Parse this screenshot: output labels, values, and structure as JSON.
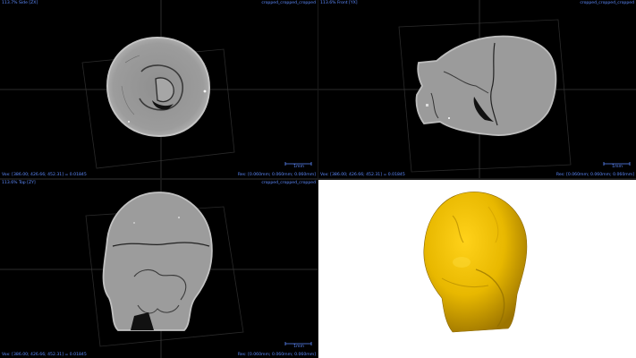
{
  "viewports": {
    "side": {
      "zoom_view": "113.7%   Side [ZX]",
      "dataset": "cropped_cropped_cropped",
      "voxel_info": "Vox:  [386.00; 426.66; 452.31] = 0.01845",
      "resolution": "Res: [0.060mm; 0.060mm; 0.060mm]",
      "scale_label": "1mm"
    },
    "front": {
      "zoom_view": "113.6%   Front [YX]",
      "dataset": "cropped_cropped_cropped",
      "voxel_info": "Vox:  [386.00; 426.66; 452.31] = 0.01845",
      "resolution": "Res: [0.060mm; 0.060mm; 0.060mm]",
      "scale_label": "1mm"
    },
    "top": {
      "zoom_view": "113.6%   Top [ZY]",
      "dataset": "cropped_cropped_cropped",
      "voxel_info": "Vox:  [386.00; 426.66; 452.31] = 0.01845",
      "resolution": "Res: [0.060mm; 0.060mm; 0.060mm]",
      "scale_label": "1mm"
    },
    "render3d": {
      "surface_color": "#e8b800"
    }
  },
  "colors": {
    "overlay_text": "#5e8bff",
    "crosshair": "#3a3a3a",
    "slice_fill": "#9a9a9a",
    "render_background": "#ffffff"
  }
}
